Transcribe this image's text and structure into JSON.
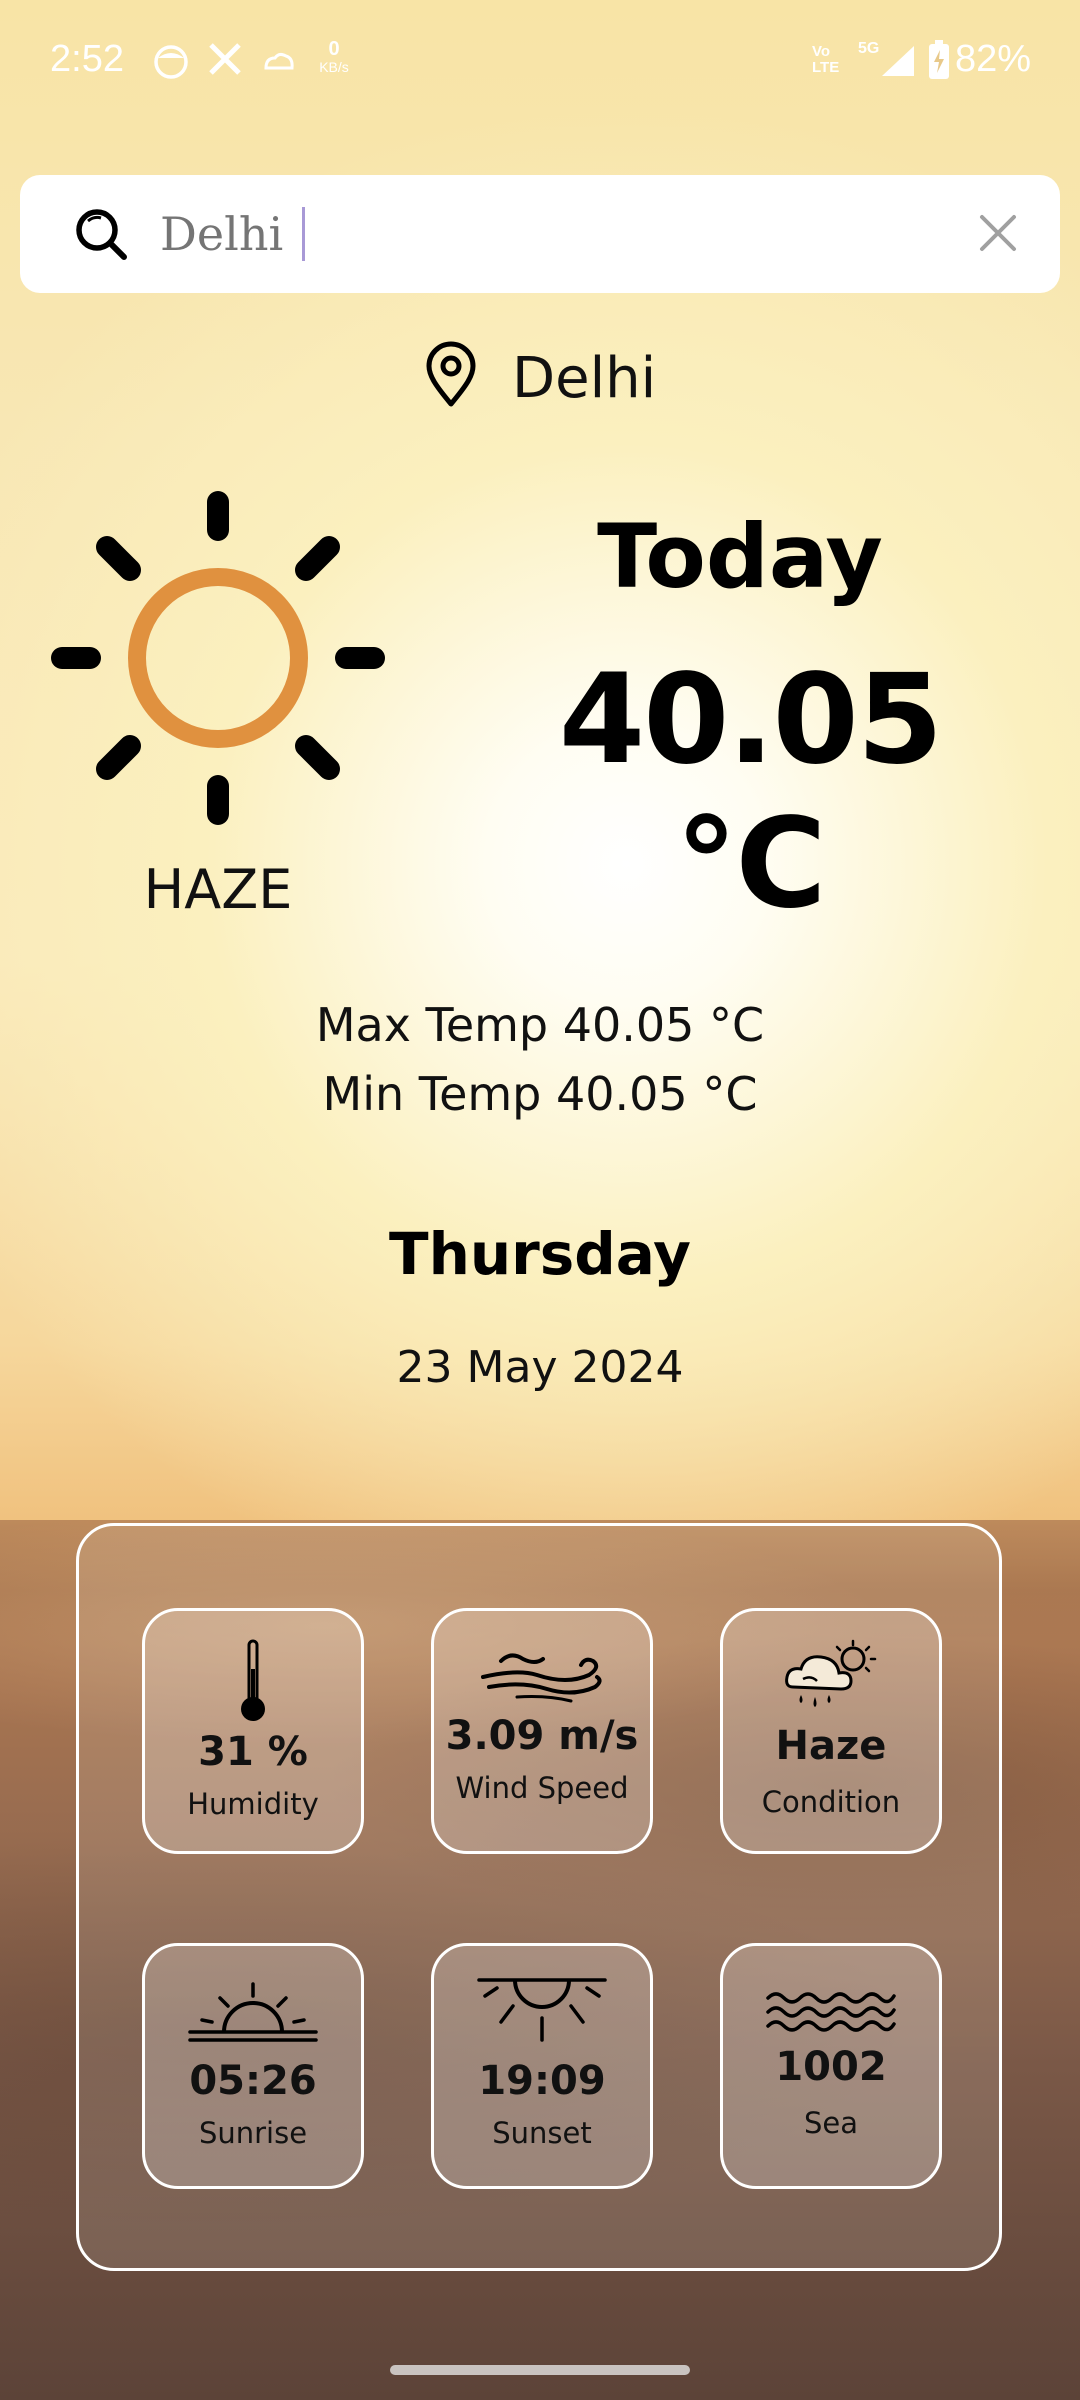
{
  "status_bar": {
    "time": "2:52",
    "net_speed_value": "0",
    "net_speed_unit": "KB/s",
    "lte_label_top": "Vo",
    "lte_label_bottom": "LTE",
    "network": "5G",
    "battery": "82%"
  },
  "search": {
    "placeholder": "Delhi",
    "value": ""
  },
  "location": {
    "name": "Delhi"
  },
  "weather": {
    "condition": "HAZE",
    "today_label": "Today",
    "temperature": "40.05 °C",
    "max_temp": "Max Temp 40.05 °C",
    "min_temp": "Min Temp 40.05 °C",
    "day": "Thursday",
    "date": "23 May 2024"
  },
  "details": [
    {
      "value": "31 %",
      "label": "Humidity",
      "icon": "thermometer-icon"
    },
    {
      "value": "3.09 m/s",
      "label": "Wind Speed",
      "icon": "wind-icon"
    },
    {
      "value": "Haze",
      "label": "Condition",
      "icon": "cloud-rain-sun-icon"
    },
    {
      "value": "05:26",
      "label": "Sunrise",
      "icon": "sunrise-icon"
    },
    {
      "value": "19:09",
      "label": "Sunset",
      "icon": "sunset-icon"
    },
    {
      "value": "1002",
      "label": "Sea",
      "icon": "waves-icon"
    }
  ],
  "colors": {
    "sun_ring": "#e0913f",
    "text": "#000000",
    "card_border": "#ffffff"
  }
}
